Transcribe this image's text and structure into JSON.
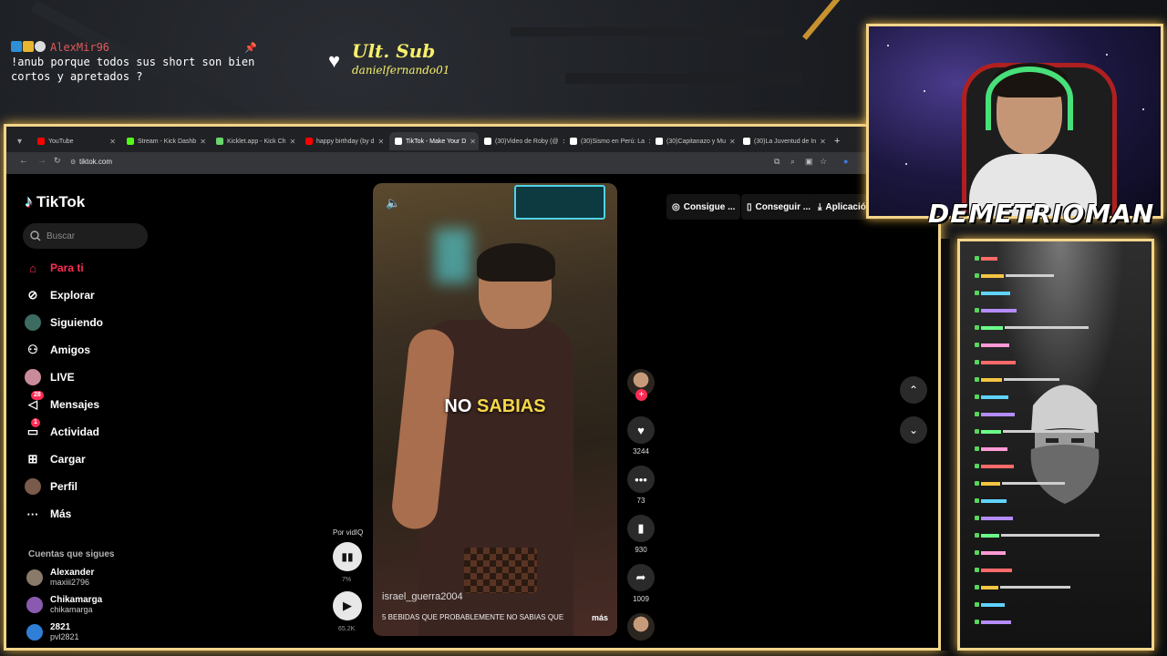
{
  "overlay": {
    "chat_user": "AlexMir96",
    "chat_text": "!anub porque todos sus short son bien cortos y apretados ?",
    "ult_sub_title": "Ult. Sub",
    "ult_sub_name": "danielfernando01",
    "streamer_name": "DEMETRIOMAN"
  },
  "browser": {
    "tabs": [
      {
        "label": "YouTube",
        "color": "#ff0000"
      },
      {
        "label": "Stream - Kick Dashb",
        "color": "#53fc18"
      },
      {
        "label": "Kicklet.app - Kick Ch",
        "color": "#6bd66b"
      },
      {
        "label": "happy birthday (by d",
        "color": "#ff0000"
      },
      {
        "label": "TikTok - Make Your D",
        "color": "#ffffff"
      },
      {
        "label": "(30)Video de Roby (@",
        "color": "#ffffff"
      },
      {
        "label": "(30)Sismo en Perú: La",
        "color": "#ffffff"
      },
      {
        "label": "(30)Capitanazo y Mu",
        "color": "#ffffff"
      },
      {
        "label": "(30)La Juventud de In",
        "color": "#ffffff"
      }
    ],
    "url": "tiktok.com"
  },
  "tiktok": {
    "logo": "TikTok",
    "search_placeholder": "Buscar",
    "nav": [
      {
        "label": "Para ti",
        "icon": "home-icon"
      },
      {
        "label": "Explorar",
        "icon": "compass-icon"
      },
      {
        "label": "Siguiendo",
        "icon": "following-icon"
      },
      {
        "label": "Amigos",
        "icon": "friends-icon"
      },
      {
        "label": "LIVE",
        "icon": "live-icon"
      },
      {
        "label": "Mensajes",
        "icon": "messages-icon",
        "badge": "28"
      },
      {
        "label": "Actividad",
        "icon": "activity-icon",
        "badge": "1"
      },
      {
        "label": "Cargar",
        "icon": "upload-icon"
      },
      {
        "label": "Perfil",
        "icon": "profile-icon"
      },
      {
        "label": "Más",
        "icon": "more-icon"
      }
    ],
    "following_title": "Cuentas que sigues",
    "following": [
      {
        "name": "Alexander",
        "handle": "maxiii2796"
      },
      {
        "name": "Chikamarga",
        "handle": "chikamarga"
      },
      {
        "name": "2821",
        "handle": "pvl2821"
      }
    ],
    "top_links": [
      "Consigue ...",
      "Conseguir ...",
      "Aplicación"
    ],
    "video": {
      "caption_white": "NO",
      "caption_yellow": "SABIAS",
      "username": "israel_guerra2004",
      "description": "5 BEBIDAS QUE PROBABLEMENTE NO SABIAS QUE",
      "more": "más"
    },
    "vidiq": {
      "label": "Por vidIQ",
      "percent": "7%",
      "views": "65.2K"
    },
    "actions": {
      "likes": "3244",
      "comments": "73",
      "saves": "930",
      "shares": "1009"
    }
  }
}
